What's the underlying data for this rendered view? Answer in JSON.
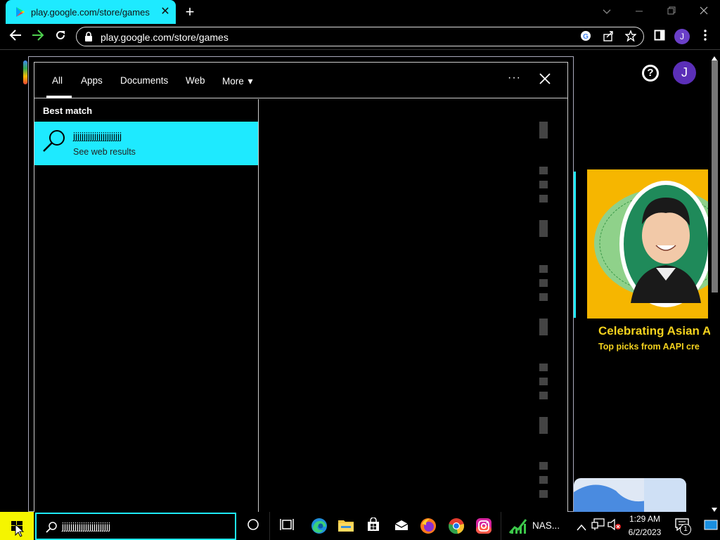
{
  "browser": {
    "tab_title": "play.google.com/store/games",
    "new_tab_symbol": "+",
    "close_symbol": "✕",
    "url": "play.google.com/store/games",
    "profile_initial": "J",
    "colors": {
      "accent": "#1eeaff",
      "avatar": "#6a3fc8"
    }
  },
  "page": {
    "profile_initial": "J",
    "help_symbol": "?",
    "promo_title": "Celebrating Asian A",
    "promo_subtitle": "Top picks from AAPI cre"
  },
  "search_flyout": {
    "tabs": [
      {
        "label": "All",
        "selected": true
      },
      {
        "label": "Apps"
      },
      {
        "label": "Documents"
      },
      {
        "label": "Web"
      },
      {
        "label": "More"
      }
    ],
    "more_caret": "▾",
    "options_symbol": "···",
    "close_symbol": "✕",
    "best_match_heading": "Best match",
    "result_title": "jjjjjjjjjjjjjjjjjjjjjjj",
    "result_subtitle": "See web results"
  },
  "taskbar": {
    "search_query": "jjjjjjjjjjjjjjjjjjjjjjj",
    "icons": [
      "windows-start-icon",
      "cortana-icon",
      "task-view-icon",
      "edge-icon",
      "file-explorer-icon",
      "store-icon",
      "mail-icon",
      "firefox-icon",
      "chrome-icon",
      "instagram-icon",
      "stock-chart-icon"
    ],
    "pinned_app_label": "NAS...",
    "clock_time": "1:29 AM",
    "clock_date": "6/2/2023",
    "notification_count": "1"
  }
}
